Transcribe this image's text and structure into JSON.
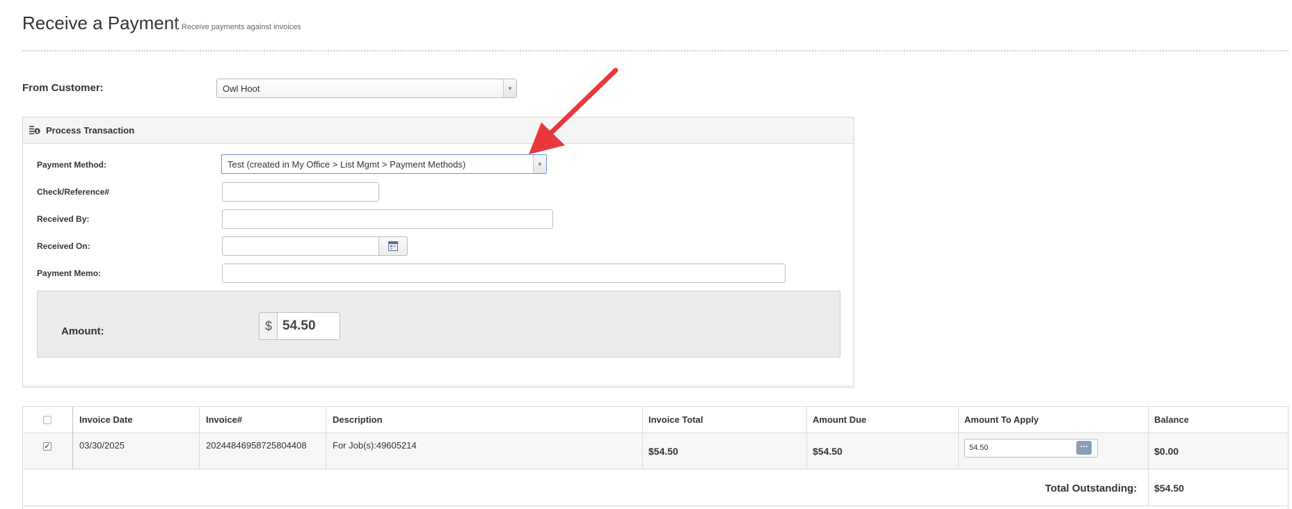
{
  "header": {
    "title": "Receive a Payment",
    "subtitle": "Receive payments against invoices"
  },
  "customer": {
    "label": "From Customer:",
    "selected": "Owl Hoot"
  },
  "panel": {
    "title": "Process Transaction",
    "icon": "coins-icon"
  },
  "form": {
    "payment_method_label": "Payment Method:",
    "payment_method_value": "Test (created in My Office > List Mgmt > Payment Methods)",
    "check_reference_label": "Check/Reference#",
    "check_reference_value": "",
    "received_by_label": "Received By:",
    "received_by_value": "",
    "received_on_label": "Received On:",
    "received_on_value": "",
    "payment_memo_label": "Payment Memo:",
    "payment_memo_value": ""
  },
  "amount": {
    "label": "Amount:",
    "currency": "$",
    "value": "54.50"
  },
  "table": {
    "columns": [
      "Invoice Date",
      "Invoice#",
      "Description",
      "Invoice Total",
      "Amount Due",
      "Amount To Apply",
      "Balance"
    ],
    "rows": [
      {
        "checked": true,
        "invoice_date": "03/30/2025",
        "invoice_number": "20244846958725804408",
        "description": "For Job(s):49605214",
        "invoice_total": "$54.50",
        "amount_due": "$54.50",
        "amount_to_apply": "54.50",
        "balance": "$0.00"
      }
    ],
    "total_outstanding_label": "Total Outstanding:",
    "total_outstanding_value": "$54.50"
  },
  "colors": {
    "annotation_arrow": "#e8383d",
    "active_border": "#6b8fd6"
  }
}
